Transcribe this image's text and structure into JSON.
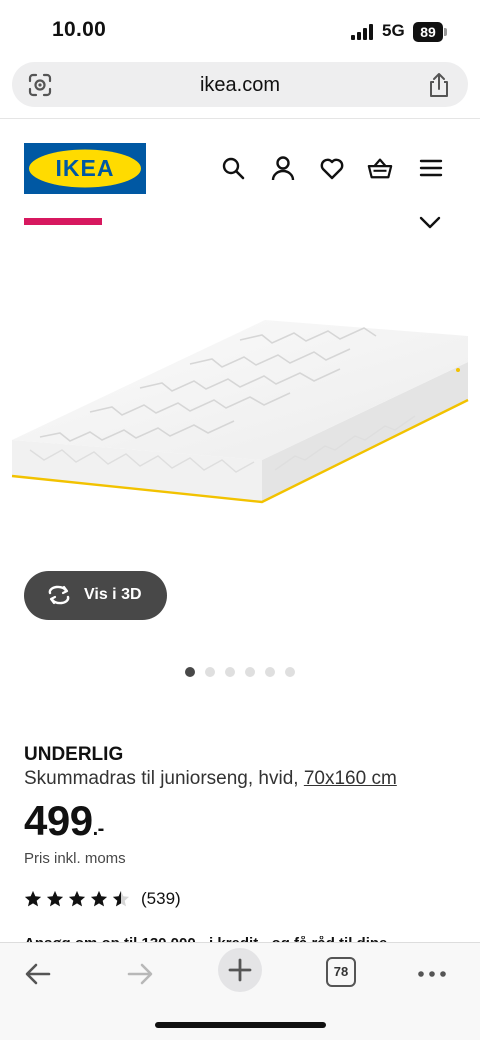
{
  "status_bar": {
    "time": "10.00",
    "network": "5G",
    "battery": "89"
  },
  "browser": {
    "url": "ikea.com",
    "tabs_count": "78"
  },
  "header": {
    "logo_text": "IKEA",
    "brand_colors": {
      "blue": "#0058a3",
      "yellow": "#ffdb00",
      "accent_pink": "#d7185f"
    },
    "icons": [
      "search-icon",
      "account-icon",
      "heart-icon",
      "basket-icon",
      "menu-icon"
    ]
  },
  "gallery": {
    "view_3d_label": "Vis i 3D",
    "image_count": 6,
    "active_index": 0
  },
  "product": {
    "name": "UNDERLIG",
    "description": "Skummadras til juniorseng, hvid, ",
    "size": "70x160 cm",
    "price": "499",
    "price_suffix": ".-",
    "vat_note": "Pris inkl. moms",
    "rating": 4.5,
    "review_count": "(539)",
    "cut_off_text": "Ansøg om op til 130.000,- i kredit - og få råd til dine"
  }
}
